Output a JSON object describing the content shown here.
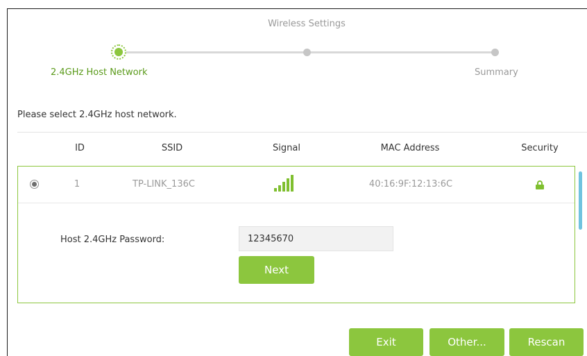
{
  "wizard": {
    "title": "Wireless Settings",
    "steps": [
      {
        "label": "2.4GHz Host Network",
        "state": "active"
      },
      {
        "label": "",
        "state": "pending"
      },
      {
        "label": "Summary",
        "state": "pending"
      }
    ]
  },
  "intro_text": "Please select 2.4GHz host network.",
  "table": {
    "columns": [
      "ID",
      "SSID",
      "Signal",
      "MAC Address",
      "Security"
    ],
    "rows": [
      {
        "selected": true,
        "id": "1",
        "ssid": "TP-LINK_136C",
        "signal_bars": 5,
        "mac": "40:16:9F:12:13:6C",
        "security": "lock-icon"
      }
    ]
  },
  "password": {
    "label": "Host 2.4GHz Password:",
    "value": "12345670"
  },
  "buttons": {
    "next": "Next",
    "exit": "Exit",
    "other": "Other...",
    "rescan": "Rescan"
  },
  "colors": {
    "accent": "#8cc63e",
    "signal": "#7fbf2f",
    "scrollbar": "#6fc3df"
  }
}
